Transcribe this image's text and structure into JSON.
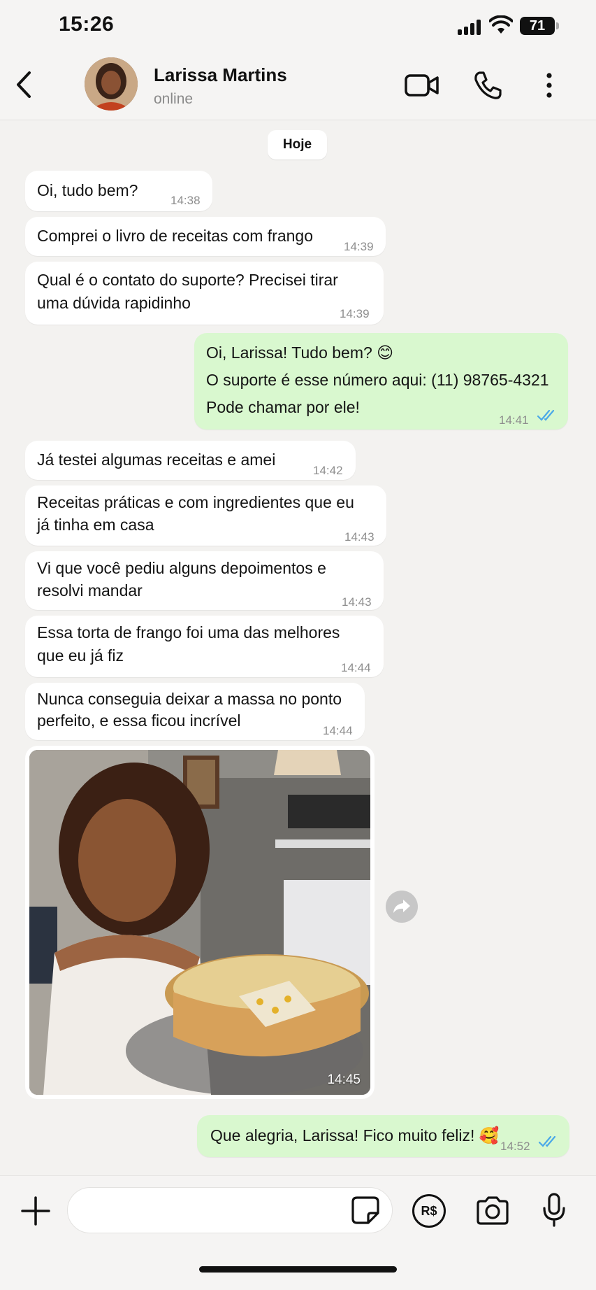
{
  "status_bar": {
    "time": "15:26",
    "battery": "71"
  },
  "header": {
    "name": "Larissa Martins",
    "status": "online"
  },
  "date_chip": "Hoje",
  "messages": [
    {
      "dir": "in",
      "lines": [
        "Oi, tudo bem?"
      ],
      "time": "14:38"
    },
    {
      "dir": "in",
      "lines": [
        "Comprei o livro de receitas com frango"
      ],
      "time": "14:39"
    },
    {
      "dir": "in",
      "lines": [
        "Qual é o contato do suporte? Precisei tirar",
        "uma dúvida rapidinho"
      ],
      "time": "14:39"
    },
    {
      "dir": "out",
      "lines": [
        "Oi, Larissa! Tudo bem? 😊",
        "O suporte é esse número aqui: (11) 98765-4321",
        "Pode chamar por ele!"
      ],
      "time": "14:41"
    },
    {
      "dir": "in",
      "lines": [
        "Já testei algumas receitas e amei"
      ],
      "time": "14:42"
    },
    {
      "dir": "in",
      "lines": [
        "Receitas práticas e com ingredientes que eu",
        "já tinha em casa"
      ],
      "time": "14:43"
    },
    {
      "dir": "in",
      "lines": [
        "Vi que você pediu alguns depoimentos e",
        "resolvi mandar"
      ],
      "time": "14:43"
    },
    {
      "dir": "in",
      "lines": [
        "Essa torta de frango foi uma das melhores",
        "que eu já fiz"
      ],
      "time": "14:44"
    },
    {
      "dir": "in",
      "lines": [
        "Nunca conseguia deixar a massa no ponto",
        "perfeito, e essa ficou incrível"
      ],
      "time": "14:44"
    },
    {
      "dir": "out",
      "lines": [
        "Que alegria, Larissa! Fico muito feliz! 🥰"
      ],
      "time": "14:52"
    }
  ],
  "photo": {
    "time": "14:45"
  },
  "composer": {
    "placeholder": "",
    "pay_label": "R$"
  },
  "icons": {
    "back": "chevron-left-icon",
    "video": "video-camera-icon",
    "call": "phone-icon",
    "more": "vertical-dots-icon",
    "read": "double-check-icon",
    "forward": "forward-arrow-icon",
    "plus": "plus-icon",
    "sticker": "sticker-icon",
    "camera": "camera-icon",
    "mic": "microphone-icon"
  },
  "colors": {
    "incoming_bubble": "#ffffff",
    "outgoing_bubble": "#d9f8cf",
    "read_ticks": "#4aa8e8",
    "background": "#f3f2f0"
  }
}
